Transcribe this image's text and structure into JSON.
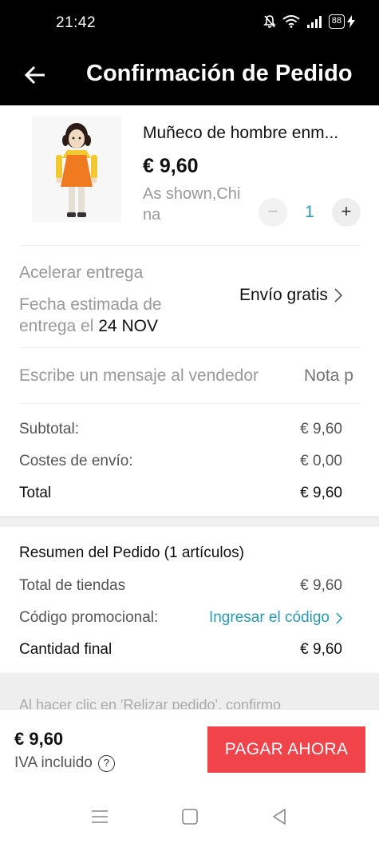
{
  "status_bar": {
    "time": "21:42",
    "battery": "88",
    "icons": [
      "mute-icon",
      "wifi-icon",
      "signal-icon",
      "battery-icon",
      "charging-icon"
    ]
  },
  "header": {
    "title": "Confirmación de Pedido",
    "back_icon": "arrow-left-icon"
  },
  "product": {
    "title": "Muñeco de hombre enm...",
    "price": "€ 9,60",
    "variant": "As shown,China",
    "quantity": "1",
    "minus": "−",
    "plus": "+"
  },
  "shipping": {
    "label": "Acelerar entrega",
    "date_prefix": "Fecha estimada de entrega el",
    "date": "24 NOV",
    "option": "Envío gratis"
  },
  "message": {
    "label": "Escribe un mensaje al vendedor",
    "placeholder": "Nota p"
  },
  "totals": [
    {
      "label": "Subtotal:",
      "value": "€ 9,60"
    },
    {
      "label": "Costes de envío:",
      "value": "€ 0,00"
    },
    {
      "label": "Total",
      "value": "€ 9,60"
    }
  ],
  "summary": {
    "title": "Resumen del Pedido (1 artículos)",
    "stores_total_label": "Total de tiendas",
    "stores_total_value": "€ 9,60",
    "promo_label": "Código promocional:",
    "promo_link": "Ingresar el código",
    "final_label": "Cantidad final",
    "final_value": "€ 9,60"
  },
  "disclaimer": "Al hacer clic en 'Relizar pedido', confirmo",
  "footer": {
    "total": "€ 9,60",
    "vat": "IVA incluido",
    "help": "?",
    "pay_button": "PAGAR AHORA"
  },
  "colors": {
    "accent": "#2a9bb0",
    "pay_button": "#f0434a",
    "header_bg": "#000000"
  }
}
